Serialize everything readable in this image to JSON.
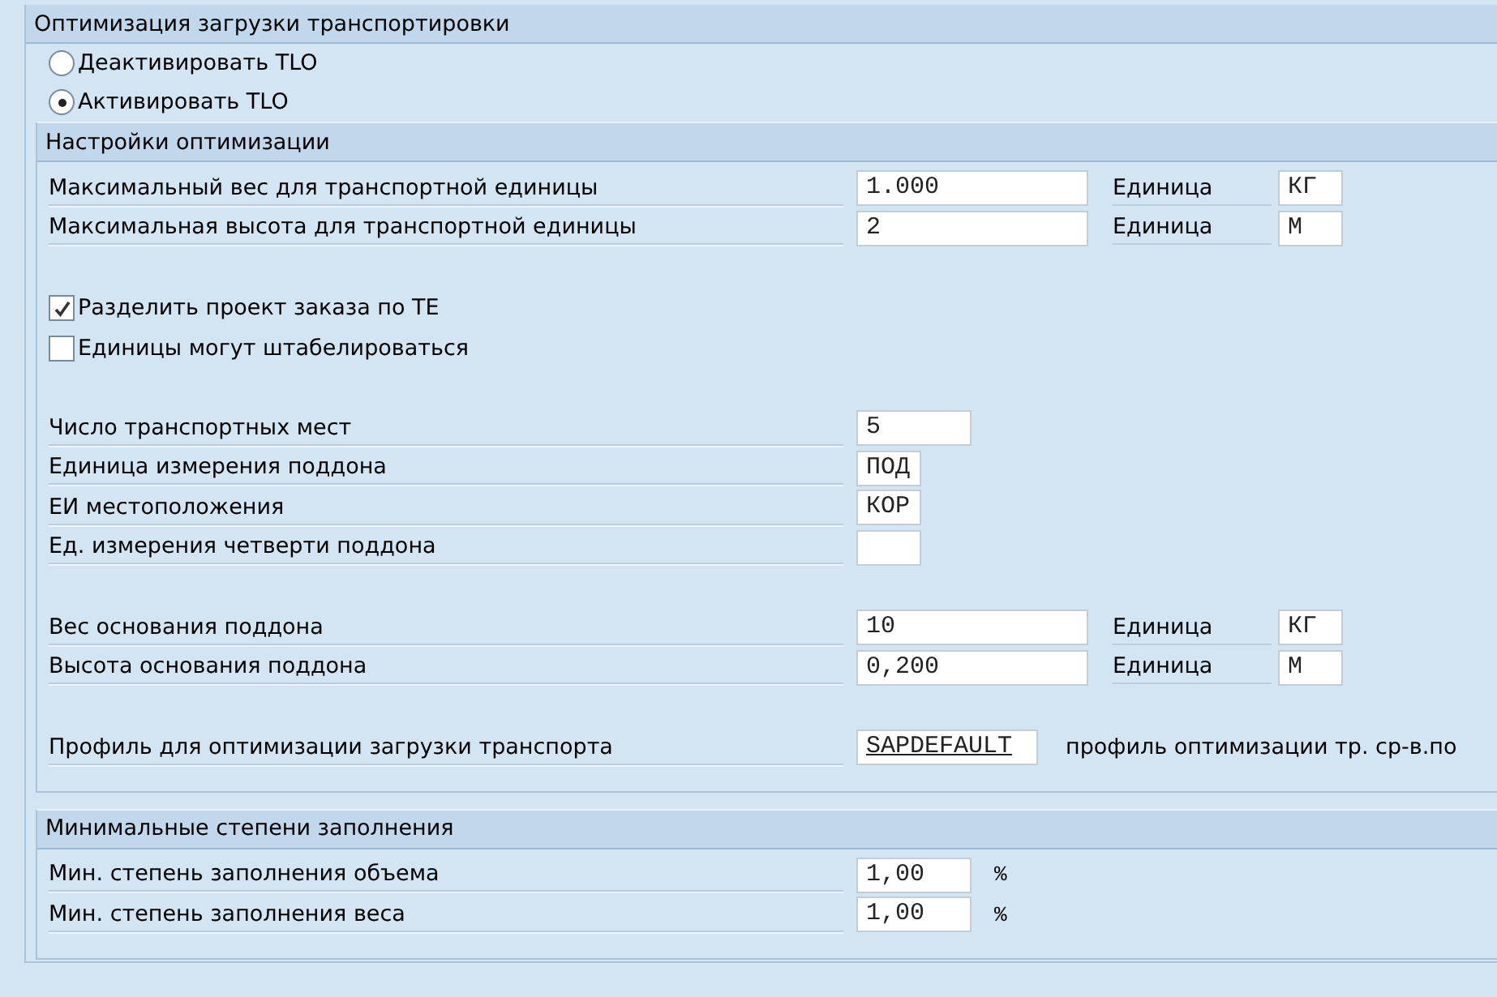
{
  "title": "Оптимизация загрузки транспортировки",
  "radios": [
    {
      "label": "Деактивировать TLO",
      "selected": false
    },
    {
      "label": "Активировать TLO",
      "selected": true
    }
  ],
  "groups": [
    {
      "title": "Настройки оптимизации",
      "blocks": [
        [
          {
            "kind": "field",
            "label": "Максимальный вес для транспортной единицы",
            "input": {
              "kind": "wide",
              "value": "1.000"
            },
            "unit_label": "Единица",
            "unit_value": "КГ"
          },
          {
            "kind": "field",
            "label": "Максимальная высота для транспортной единицы",
            "input": {
              "kind": "wide",
              "value": "2"
            },
            "unit_label": "Единица",
            "unit_value": "М"
          }
        ],
        [
          {
            "kind": "checkbox",
            "label": "Разделить проект заказа по ТЕ",
            "checked": true
          },
          {
            "kind": "checkbox",
            "label": "Единицы могут штабелироваться",
            "checked": false
          }
        ],
        [
          {
            "kind": "field",
            "label": "Число транспортных мест",
            "input": {
              "kind": "medium",
              "value": "5"
            }
          },
          {
            "kind": "field",
            "label": "Единица измерения поддона",
            "input": {
              "kind": "short",
              "value": "ПОД"
            }
          },
          {
            "kind": "field",
            "label": "ЕИ местоположения",
            "input": {
              "kind": "short",
              "value": "КОР"
            }
          },
          {
            "kind": "field",
            "label": "Ед. измерения четверти поддона",
            "input": {
              "kind": "short"
            }
          }
        ],
        [
          {
            "kind": "field",
            "label": "Вес основания поддона",
            "input": {
              "kind": "wide",
              "value": "10"
            },
            "unit_label": "Единица",
            "unit_value": "КГ"
          },
          {
            "kind": "field",
            "label": "Высота основания поддона",
            "input": {
              "kind": "wide",
              "value": "0,200"
            },
            "unit_label": "Единица",
            "unit_value": "М"
          }
        ],
        [
          {
            "kind": "field",
            "label": "Профиль для оптимизации загрузки транспорта",
            "input": {
              "kind": "profile",
              "value": "SAPDEFAULT"
            },
            "note": "профиль оптимизации тр. ср-в.по"
          }
        ]
      ]
    },
    {
      "title": "Минимальные степени заполнения",
      "blocks": [
        [
          {
            "kind": "field",
            "label": "Мин. степень заполнения объема",
            "input": {
              "kind": "medium",
              "value": "1,00"
            },
            "suffix": "%"
          },
          {
            "kind": "field",
            "label": "Мин. степень заполнения веса",
            "input": {
              "kind": "medium",
              "value": "1,00"
            },
            "suffix": "%"
          }
        ]
      ]
    }
  ]
}
